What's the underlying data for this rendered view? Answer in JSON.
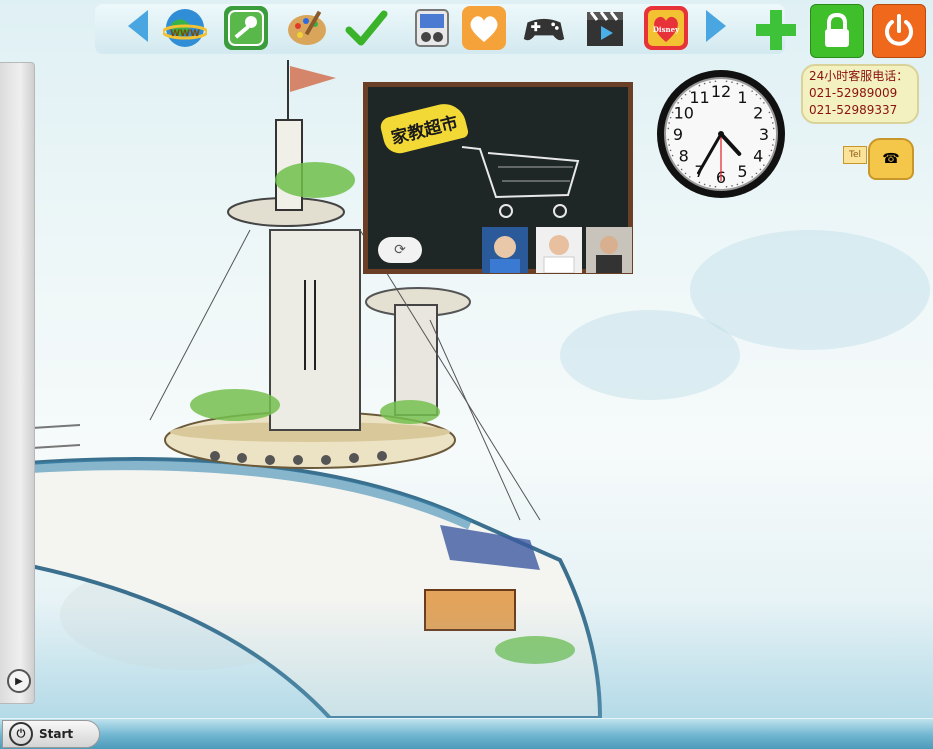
{
  "dock": {
    "icons": [
      {
        "name": "internet-globe-icon",
        "label": "WWW"
      },
      {
        "name": "settings-key-icon",
        "label": ""
      },
      {
        "name": "paint-palette-icon",
        "label": ""
      },
      {
        "name": "checkmark-icon",
        "label": ""
      },
      {
        "name": "media-player-icon",
        "label": ""
      },
      {
        "name": "chat-app-icon",
        "label": ""
      },
      {
        "name": "gamepad-icon",
        "label": ""
      },
      {
        "name": "video-clapper-icon",
        "label": ""
      },
      {
        "name": "disney-icon",
        "label": "Disney"
      }
    ]
  },
  "system": {
    "add_icon": "+",
    "lock_icon": "lock",
    "power_icon": "power"
  },
  "board": {
    "title": "家教超市",
    "refresh_symbol": "⟳"
  },
  "clock": {
    "numbers": [
      "12",
      "1",
      "2",
      "3",
      "4",
      "5",
      "6",
      "7",
      "8",
      "9",
      "10",
      "11"
    ],
    "hour": 4,
    "minute": 35,
    "second": 30
  },
  "hotline": {
    "title": "24小时客服电话：",
    "phone1": "021-52989009",
    "phone2": "021-52989337",
    "tel_label": "Tel"
  },
  "taskbar": {
    "start_label": "Start"
  },
  "colors": {
    "lock_green": "#3fbf2a",
    "power_orange": "#f0681c",
    "add_green": "#3ec23a"
  }
}
